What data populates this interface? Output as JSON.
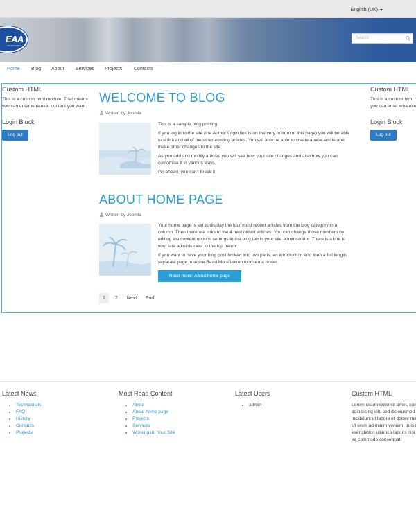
{
  "topbar": {
    "language": "English (UK)"
  },
  "banner": {
    "logo_text": "EAA",
    "logo_sub": "ADVENTURES",
    "search_placeholder": "Search"
  },
  "nav": {
    "items": [
      "Home",
      "Blog",
      "About",
      "Services",
      "Projects",
      "Contacts"
    ]
  },
  "left": {
    "custom_title": "Custom HTML",
    "custom_text": "This is a custom html module. That means you can enter whatever content you want.",
    "login_title": "Login Block",
    "logout": "Log out"
  },
  "right": {
    "custom_title": "Custom HTML",
    "custom_text": "This is a custom html module. That means you can enter whatever content you want.",
    "login_title": "Login Block",
    "logout": "Log out"
  },
  "articles": [
    {
      "title": "WELCOME TO BLOG",
      "author": "Written by Joomla",
      "paragraphs": [
        "This is a sample blog posting.",
        "If you log in to the site (the Author Login link is on the very bottom of this page) you will be able to edit it and all of the other existing articles. You will also be able to create a new article and make other changes to the site.",
        "As you add and modify articles you will see how your site changes and also how you can customise it in various ways.",
        "Go ahead, you can't break it."
      ]
    },
    {
      "title": "ABOUT HOME PAGE",
      "author": "Written by Joomla",
      "paragraphs": [
        "Your home page is set to display the four most recent articles from the blog category in a column. Then there are links to the 4 nest oldest articles. You can change those numbers by editing the content options settings in the blog tab in your site administrator. There is a link to your site administrator in the top menu.",
        "If you want to have your blog post broken into two parts, an introduction and then a full length separate page, use the Read More button to insert a break."
      ],
      "readmore": "Read more: About home page"
    }
  ],
  "pagination": {
    "current": "1",
    "page2": "2",
    "next": "Next",
    "end": "End"
  },
  "footer": {
    "latest_news": {
      "title": "Latest News",
      "items": [
        "Testimonials",
        "FAQ",
        "History",
        "Contacts",
        "Projects"
      ]
    },
    "most_read": {
      "title": "Most Read Content",
      "items": [
        "About",
        "About home page",
        "Projects",
        "Services",
        "Working on Your Site"
      ]
    },
    "latest_users": {
      "title": "Latest Users",
      "items": [
        "admin"
      ]
    },
    "custom": {
      "title": "Custom HTML",
      "text": "Lorem ipsum dolor sit amet, consectetur adipisicing elit, sed do eiusmod tempor incididunt ut labore et dolore magna aliqua. Ut enim ad minim veniam, quis nostrud exercitation ullamco laboris nisi ut aliquip ex ea commodo consequat."
    }
  },
  "colors": {
    "accent": "#2a9fd6",
    "link": "#2a8fc7",
    "button": "#2d7cc4",
    "frame": "#4ab6dc"
  }
}
